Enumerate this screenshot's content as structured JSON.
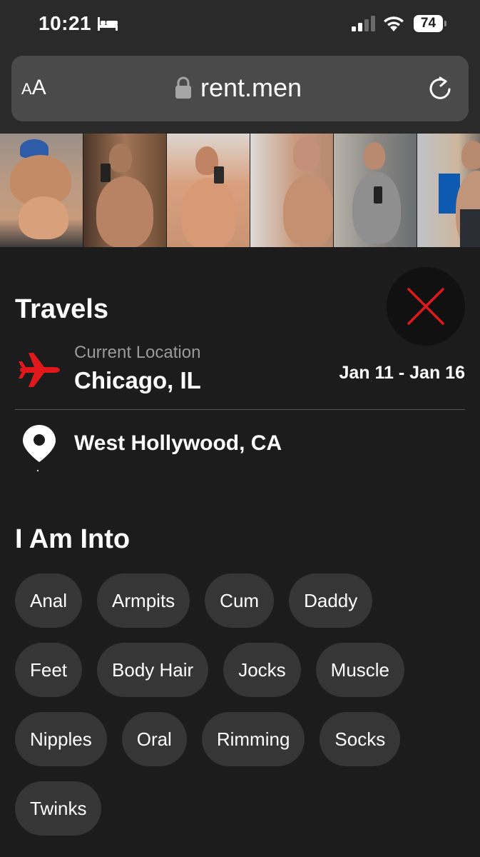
{
  "status_bar": {
    "time": "10:21",
    "battery_level": "74",
    "icons": [
      "bed-icon",
      "cellular-signal-icon",
      "wifi-icon",
      "battery-icon"
    ]
  },
  "browser": {
    "text_size_label_small": "A",
    "text_size_label_large": "A",
    "url": "rent.men",
    "icons": [
      "lock-icon",
      "reload-icon"
    ]
  },
  "photos": {
    "count": 6
  },
  "travels": {
    "title": "Travels",
    "current_location_label": "Current Location",
    "current_location": "Chicago, IL",
    "dates": "Jan 11 - Jan 16",
    "home_location": "West Hollywood, CA",
    "icons": [
      "airplane-icon",
      "map-pin-icon",
      "close-icon"
    ]
  },
  "interests": {
    "title": "I Am Into",
    "rows": [
      [
        "Anal",
        "Armpits",
        "Cum",
        "Daddy"
      ],
      [
        "Feet",
        "Body Hair",
        "Jocks",
        "Muscle"
      ],
      [
        "Nipples",
        "Oral",
        "Rimming",
        "Socks"
      ],
      [
        "Twinks"
      ]
    ]
  },
  "colors": {
    "background": "#1c1c1c",
    "accent_red": "#e0181b",
    "tag_background": "#363636"
  }
}
